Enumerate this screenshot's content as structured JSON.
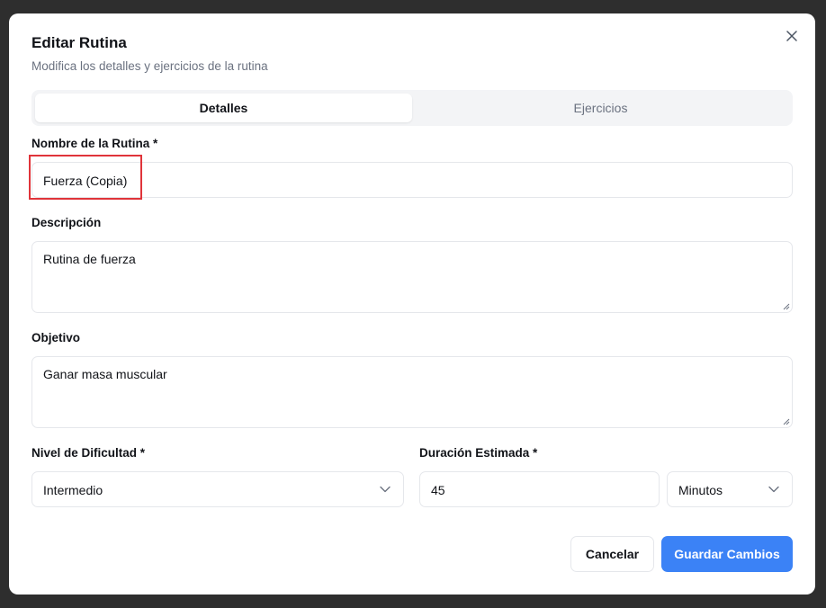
{
  "dialog": {
    "title": "Editar Rutina",
    "subtitle": "Modifica los detalles y ejercicios de la rutina",
    "close_icon": "close-icon"
  },
  "tabs": [
    {
      "label": "Detalles",
      "active": true
    },
    {
      "label": "Ejercicios",
      "active": false
    }
  ],
  "form": {
    "name": {
      "label": "Nombre de la Rutina *",
      "value": "Fuerza (Copia)"
    },
    "description": {
      "label": "Descripción",
      "value": "Rutina de fuerza"
    },
    "objective": {
      "label": "Objetivo",
      "value": "Ganar masa muscular"
    },
    "difficulty": {
      "label": "Nivel de Dificultad *",
      "value": "Intermedio"
    },
    "duration": {
      "label": "Duración Estimada *",
      "value": "45",
      "unit": "Minutos"
    }
  },
  "actions": {
    "cancel_label": "Cancelar",
    "save_label": "Guardar Cambios"
  },
  "colors": {
    "primary": "#3b82f6",
    "highlight": "#e0343a",
    "backdrop": "#2e2e2e"
  }
}
